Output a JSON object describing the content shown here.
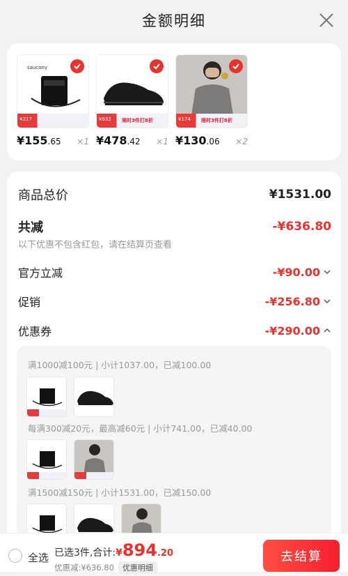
{
  "header": {
    "title": "金额明细"
  },
  "products": [
    {
      "price": "¥155",
      "price_decimal": ".65",
      "qty": "×1",
      "promo_tag": "¥217",
      "style": "bag"
    },
    {
      "price": "¥478",
      "price_decimal": ".42",
      "qty": "×1",
      "promo_tag": "¥632",
      "promo_note": "限时3件打8折",
      "style": "shoe"
    },
    {
      "price": "¥130",
      "price_decimal": ".06",
      "qty": "×2",
      "promo_tag": "¥174",
      "promo_note": "限时3件打8折",
      "style": "person"
    }
  ],
  "summary": {
    "total_label": "商品总价",
    "total_value": "¥1531.00",
    "reduce_label": "共减",
    "reduce_value": "-¥636.80",
    "hint": "以下优惠不包含红包，请在结算页查看",
    "official_label": "官方立减",
    "official_value": "-¥90.00",
    "promo_label": "促销",
    "promo_value": "-¥256.80",
    "coupon_label": "优惠券",
    "coupon_value": "-¥290.00"
  },
  "coupons": [
    {
      "title": "满1000减100元 | 小计1037.00，已减100.00"
    },
    {
      "title": "每满300减20元，最高减60元 | 小计741.00，已减40.00"
    },
    {
      "title": "满1500减150元 | 小计1531.00，已减150.00"
    }
  ],
  "footer": {
    "select_all": "全选",
    "selected_text": "已选3件,合计:",
    "currency": "¥",
    "total_int": "894",
    "total_dec": ".20",
    "saved_text": "优惠减:¥636.80",
    "detail_chip": "优惠明细",
    "checkout": "去结算"
  },
  "colors": {
    "accent": "#e8322e",
    "button_start": "#ff4f43",
    "button_end": "#f4202e"
  }
}
